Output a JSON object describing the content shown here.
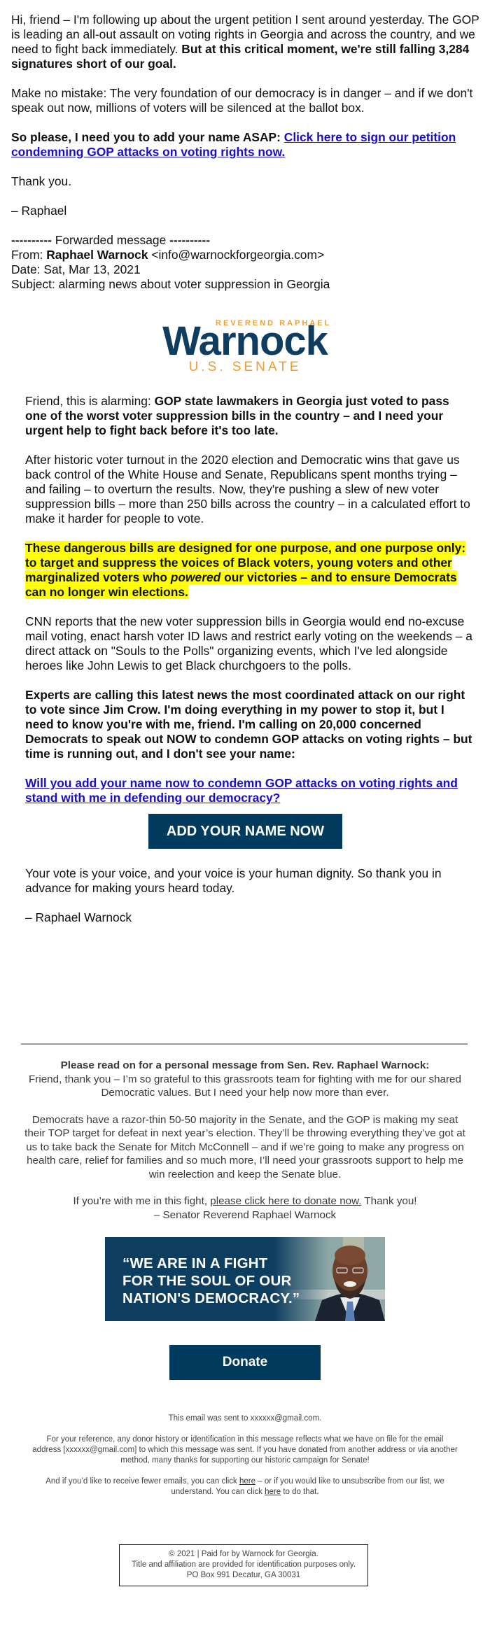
{
  "forward_note": {
    "p1_plain": "Hi, friend – I'm following up about the urgent petition I sent around yesterday. The GOP is leading an all-out assault on voting rights in Georgia and across the country, and we need to fight back immediately. ",
    "p1_bold": "But at this critical moment, we're still falling 3,284 signatures short of our goal.",
    "p2": "Make no mistake: The very foundation of our democracy is in danger – and if we don't speak out now, millions of voters will be silenced at the ballot box.",
    "p3_bold": "So please, I need you to add your name ASAP: ",
    "p3_link": "Click here to sign our petition condemning GOP attacks on voting rights now.",
    "thanks": "Thank you.",
    "signoff": "– Raphael"
  },
  "forwarded_header": {
    "separator_dashes": "----------",
    "separator_label": " Forwarded message ",
    "from_label": "From: ",
    "from_name": "Raphael Warnock",
    "from_email": " <info@warnockforgeorgia.com>",
    "date": "Date: Sat, Mar 13, 2021",
    "subject": "Subject: alarming news about voter suppression in Georgia"
  },
  "logo": {
    "top_line": "REVEREND RAPHAEL",
    "name": "Warnock",
    "bottom_line": "U.S. SENATE",
    "navy": "#0f3d5f",
    "orange": "#f29d2b"
  },
  "email_body": {
    "p1_plain": "Friend, this is alarming: ",
    "p1_bold": "GOP state lawmakers in Georgia just voted to pass one of the worst voter suppression bills in the country – and I need your urgent help to fight back before it's too late.",
    "p2": "After historic voter turnout in the 2020 election and Democratic wins that gave us back control of the White House and Senate, Republicans spent months trying – and failing – to overturn the results. Now, they're pushing a slew of new voter suppression bills – more than 250 bills across the country – in a calculated effort to make it harder for people to vote.",
    "p3_before": "These dangerous bills are designed for one purpose, and one purpose only: to target and suppress the voices of Black voters, young voters and other marginalized voters who ",
    "p3_italic": "powered",
    "p3_after": " our victories – and to ensure Democrats can no longer win elections.",
    "p4": "CNN reports that the new voter suppression bills in Georgia would end no-excuse mail voting, enact harsh voter ID laws and restrict early voting on the weekends – a direct attack on \"Souls to the Polls\" organizing events, which I've led alongside heroes like John Lewis to get Black churchgoers to the polls.",
    "p5_bold": "Experts are calling this latest news the most coordinated attack on our right to vote since Jim Crow. I'm doing everything in my power to stop it, but I need to know you're with me, friend. I'm calling on 20,000 concerned Democrats to speak out NOW to condemn GOP attacks on voting rights – but time is running out, and I don't see your name:",
    "p6_link": "Will you add your name now to condemn GOP attacks on voting rights and stand with me in defending our democracy?",
    "cta_button": "ADD YOUR NAME NOW",
    "p7": "Your vote is your voice, and your voice is your human dignity. So thank you in advance for making yours heard today.",
    "signoff": "– Raphael Warnock"
  },
  "personal_message": {
    "heading": "Please read on for a personal message from Sen. Rev. Raphael Warnock:",
    "p1": "Friend, thank you – I’m so grateful to this grassroots team for fighting with me for our shared Democratic values. But I need your help now more than ever.",
    "p2": "Democrats have a razor-thin 50-50 majority in the Senate, and the GOP is making my seat their TOP target for defeat in next year’s election. They’ll be throwing everything they’ve got at us to take back the Senate for Mitch McConnell – and if we’re going to make any progress on health care, relief for families and so much more, I’ll need your grassroots support to help me win reelection and keep the Senate blue.",
    "p3_before": "If you’re with me in this fight, ",
    "p3_link": "please click here to donate now.",
    "p3_after": " Thank you!",
    "signoff": "– Senator Reverend Raphael Warnock"
  },
  "banner": {
    "line1": "“WE ARE IN A FIGHT",
    "line2": "FOR THE SOUL OF OUR",
    "line3": "NATION'S DEMOCRACY.”",
    "bg_color": "#0d3d5f"
  },
  "donate_button": "Donate",
  "footer": {
    "sent_to": "This email was sent to xxxxxx@gmail.com.",
    "reference": "For your reference, any donor history or identification in this message reflects what we have on file for the email address [xxxxxx@gmail.com] to which this message was sent. If you have donated from another address or via another method, many thanks for supporting our historic campaign for Senate!",
    "fewer_before": "And if you’d like to receive fewer emails, you can click ",
    "fewer_link": "here",
    "fewer_middle": " – or if you would like to unsubscribe from our list, we understand. You can click ",
    "unsub_link": "here",
    "fewer_after": " to do that.",
    "box_line1": "© 2021 | Paid for by Warnock for Georgia.",
    "box_line2": "Title and affiliation are provided for identification purposes only.",
    "box_line3": "PO Box 991 Decatur, GA 30031"
  },
  "colors": {
    "button_navy": "#003a5d",
    "link_blue": "#1a0dcc",
    "highlight_yellow": "#ffff00"
  }
}
